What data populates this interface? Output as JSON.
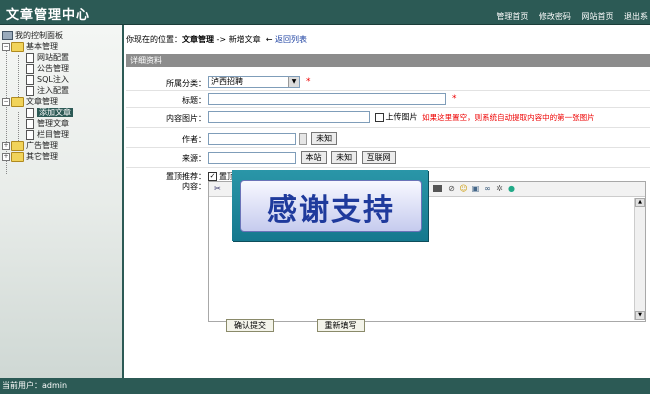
{
  "app": {
    "title": "文章管理中心"
  },
  "top_links": [
    "管理首页",
    "修改密码",
    "网站首页",
    "退出系"
  ],
  "sidebar": {
    "root": "我的控制面板",
    "groups": [
      {
        "label": "基本管理",
        "items": [
          "网站配置",
          "公告管理",
          "SQL注入",
          "注入配置"
        ]
      },
      {
        "label": "文章管理",
        "items": [
          "添加文章",
          "管理文章",
          "栏目管理"
        ]
      },
      {
        "label": "广告管理",
        "items": []
      },
      {
        "label": "其它管理",
        "items": []
      }
    ]
  },
  "breadcrumb": {
    "prefix": "你现在的位置：",
    "section": "文章管理",
    "arrow": "->",
    "page": "新增文章",
    "back_icon": "←",
    "back": "返回列表"
  },
  "section_title": "详细资料",
  "form": {
    "category": {
      "label": "所属分类：",
      "value": "泸西招聘",
      "required_mark": "*"
    },
    "title": {
      "label": "标题：",
      "value": "",
      "required_mark": "*"
    },
    "image": {
      "label": "内容图片：",
      "value": "",
      "upload_label": "上传图片",
      "hint": "如果这里置空，则系统自动提取内容中的第一张图片"
    },
    "author": {
      "label": "作者：",
      "value": "",
      "unknown_btn": "未知"
    },
    "source": {
      "label": "来源：",
      "value": "",
      "buttons": [
        "本站",
        "未知",
        "互联网"
      ]
    },
    "top": {
      "label": "置顶推荐：",
      "option": "置顶",
      "checked": true
    },
    "content": {
      "label": "内容："
    }
  },
  "overlay": {
    "text": "感谢支持"
  },
  "actions": {
    "submit": "确认提交",
    "reset": "重新填写"
  },
  "status": {
    "user": "当前用户：admin"
  },
  "colors": {
    "header": "#2c5a55",
    "section_bar": "#8c8c8c",
    "required": "#e00000",
    "overlay": "#1f3a9c"
  }
}
